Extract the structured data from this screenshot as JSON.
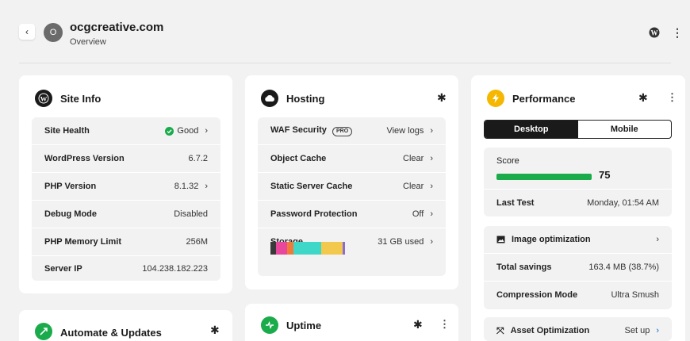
{
  "header": {
    "back_icon": "chevron-left-icon",
    "avatar_letter": "O",
    "site_name": "ocgcreative.com",
    "subtitle": "Overview",
    "wp_icon": "wordpress-icon",
    "menu_icon": "more-vertical-icon"
  },
  "site_info": {
    "title": "Site Info",
    "rows": [
      {
        "label": "Site Health",
        "value": "Good"
      },
      {
        "label": "WordPress Version",
        "value": "6.7.2"
      },
      {
        "label": "PHP Version",
        "value": "8.1.32"
      },
      {
        "label": "Debug Mode",
        "value": "Disabled"
      },
      {
        "label": "PHP Memory Limit",
        "value": "256M"
      },
      {
        "label": "Server IP",
        "value": "104.238.182.223"
      }
    ]
  },
  "hosting": {
    "title": "Hosting",
    "rows": [
      {
        "label": "WAF Security",
        "badge": "PRO",
        "value": "View logs"
      },
      {
        "label": "Object Cache",
        "value": "Clear"
      },
      {
        "label": "Static Server Cache",
        "value": "Clear"
      },
      {
        "label": "Password Protection",
        "value": "Off"
      },
      {
        "label": "Storage",
        "value": "31 GB used"
      }
    ],
    "storage_colors": [
      "#3a3a3a",
      "#e8479b",
      "#f07a3a",
      "#3fd8c8",
      "#f2c94c",
      "#8a6bd6"
    ]
  },
  "performance": {
    "title": "Performance",
    "tabs": [
      "Desktop",
      "Mobile"
    ],
    "score_label": "Score",
    "score_value": "75",
    "score_fraction": 0.75,
    "last_test_label": "Last Test",
    "last_test_value": "Monday, 01:54 AM"
  },
  "image_opt": {
    "title": "Image optimization",
    "rows": [
      {
        "label": "Total savings",
        "value": "163.4 MB (38.7%)"
      },
      {
        "label": "Compression Mode",
        "value": "Ultra Smush"
      }
    ]
  },
  "asset_opt": {
    "title": "Asset Optimization",
    "action": "Set up"
  },
  "automate": {
    "title": "Automate & Updates"
  },
  "uptime": {
    "title": "Uptime"
  },
  "colors": {
    "good": "#1aab4b",
    "performance_icon": "#f5b700",
    "automate_icon": "#1aab4b",
    "uptime_icon": "#1aab4b",
    "link": "#1768d6"
  }
}
